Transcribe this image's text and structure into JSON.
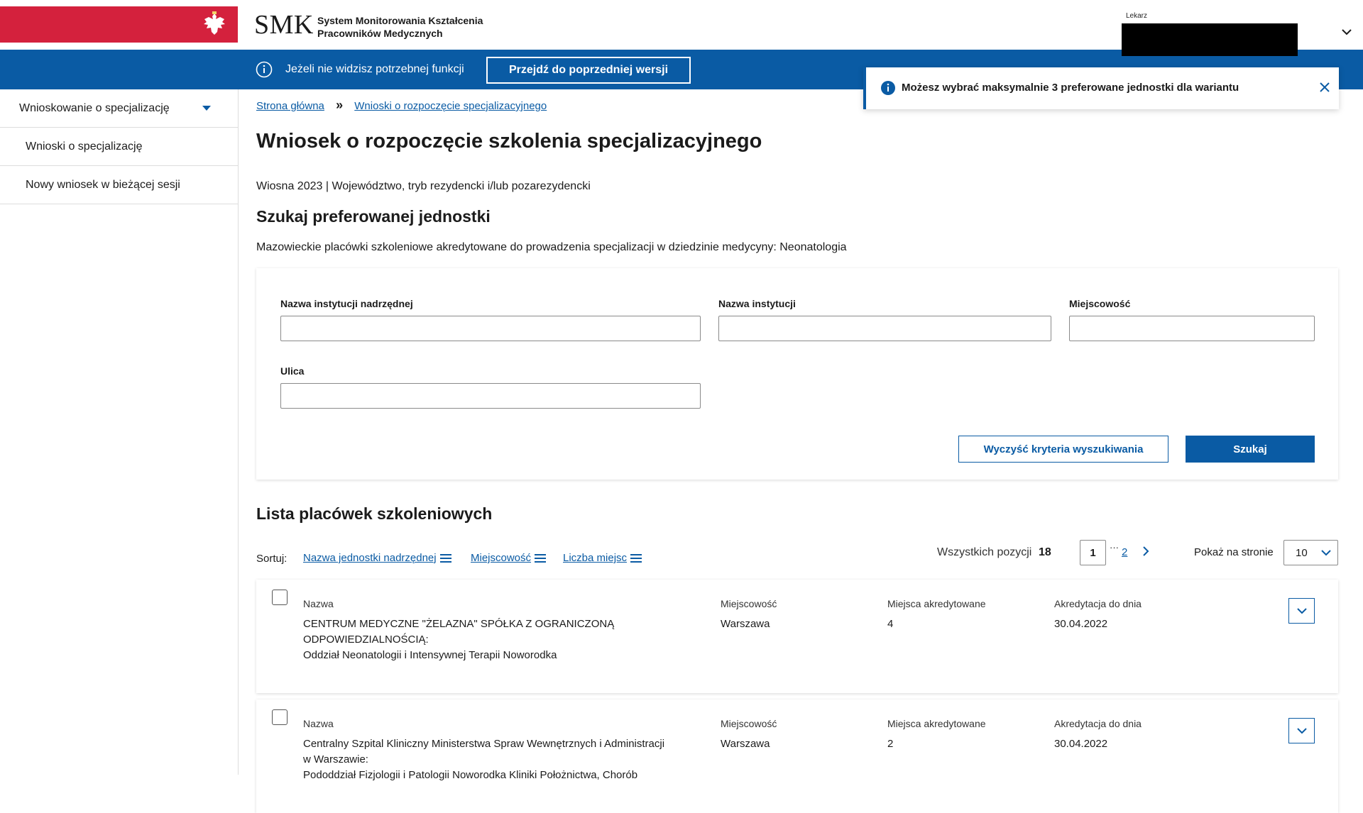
{
  "header": {
    "logo_text": "SMK",
    "subtitle_line1": "System Monitorowania Kształcenia",
    "subtitle_line2": "Pracowników Medycznych",
    "user_role": "Lekarz",
    "emblem_icon": "polish-eagle-icon",
    "flag_color": "#d4213d"
  },
  "bluebar": {
    "message": "Jeżeli nie widzisz potrzebnej funkcji",
    "button_label": "Przejdź do poprzedniej wersji",
    "color": "#0a5ba4"
  },
  "toast": {
    "text": "Możesz wybrać maksymalnie 3 preferowane jednostki dla wariantu"
  },
  "sidebar": {
    "main": "Wnioskowanie o specjalizację",
    "items": [
      {
        "label": "Wnioski o specjalizację"
      },
      {
        "label": "Nowy wniosek w bieżącej sesji"
      }
    ]
  },
  "breadcrumb": {
    "home": "Strona główna",
    "separator": "»",
    "current": "Wnioski o rozpoczęcie specjalizacyjnego"
  },
  "page": {
    "title": "Wniosek o rozpoczęcie szkolenia specjalizacyjnego",
    "session_info": "Wiosna 2023 | Województwo, tryb rezydencki i/lub pozarezydencki",
    "search_heading": "Szukaj preferowanej jednostki",
    "search_desc": "Mazowieckie placówki szkoleniowe akredytowane do prowadzenia specjalizacji w dziedzinie medycyny: Neonatologia"
  },
  "search": {
    "parent_label": "Nazwa instytucji nadrzędnej",
    "parent_value": "",
    "institution_label": "Nazwa instytucji",
    "institution_value": "",
    "city_label": "Miejscowość",
    "city_value": "",
    "street_label": "Ulica",
    "street_value": "",
    "clear_button": "Wyczyść kryteria wyszukiwania",
    "search_button": "Szukaj"
  },
  "list": {
    "heading": "Lista placówek szkoleniowych",
    "sort_label": "Sortuj:",
    "sort_parent": "Nazwa jednostki nadrzędnej",
    "sort_city": "Miejscowość",
    "sort_places": "Liczba miejsc",
    "total_label": "Wszystkich pozycji",
    "total": "18",
    "page_current": "1",
    "page_dots": "···",
    "page_2": "2",
    "per_page_label": "Pokaż na stronie",
    "per_page": "10",
    "columns": {
      "name": "Nazwa",
      "city": "Miejscowość",
      "places": "Miejsca akredytowane",
      "accreditation": "Akredytacja do dnia"
    },
    "rows": [
      {
        "name_line1": "CENTRUM MEDYCZNE \"ŻELAZNA\" SPÓŁKA Z OGRANICZONĄ",
        "name_line2": "ODPOWIEDZIALNOŚCIĄ:",
        "name_line3": "Oddział Neonatologii i Intensywnej Terapii Noworodka",
        "city": "Warszawa",
        "places": "4",
        "accreditation": "30.04.2022",
        "checked": false
      },
      {
        "name_line1": "Centralny Szpital Kliniczny Ministerstwa Spraw Wewnętrznych i Administracji",
        "name_line2": "w Warszawie:",
        "name_line3": "Pododdział Fizjologii i Patologii Noworodka Kliniki Położnictwa, Chorób",
        "city": "Warszawa",
        "places": "2",
        "accreditation": "30.04.2022",
        "checked": false
      }
    ]
  }
}
